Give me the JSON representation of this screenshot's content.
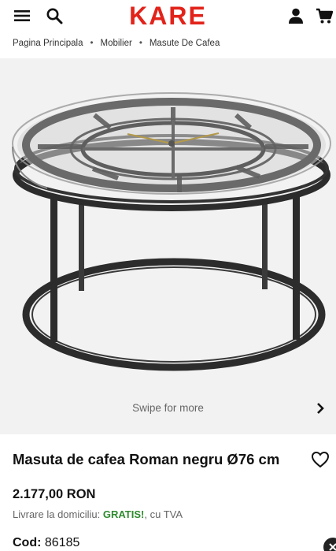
{
  "header": {
    "brand": "KARE",
    "brand_color": "#e2231a",
    "icons": [
      "menu-icon",
      "search-icon",
      "account-icon",
      "cart-icon"
    ]
  },
  "breadcrumb": [
    "Pagina Principala",
    "Mobilier",
    "Masute De Cafea"
  ],
  "gallery": {
    "swipe_label": "Swipe for more",
    "next_icon": "chevron-right-icon"
  },
  "product": {
    "title": "Masuta de cafea Roman negru Ø76 cm",
    "price": "2.177,00 RON",
    "delivery_prefix": "Livrare la domiciliu: ",
    "delivery_free": "GRATIS!",
    "delivery_suffix": ", cu TVA",
    "code_label": "Cod:",
    "code_value": "86185",
    "free_color": "#2f8a2f"
  }
}
